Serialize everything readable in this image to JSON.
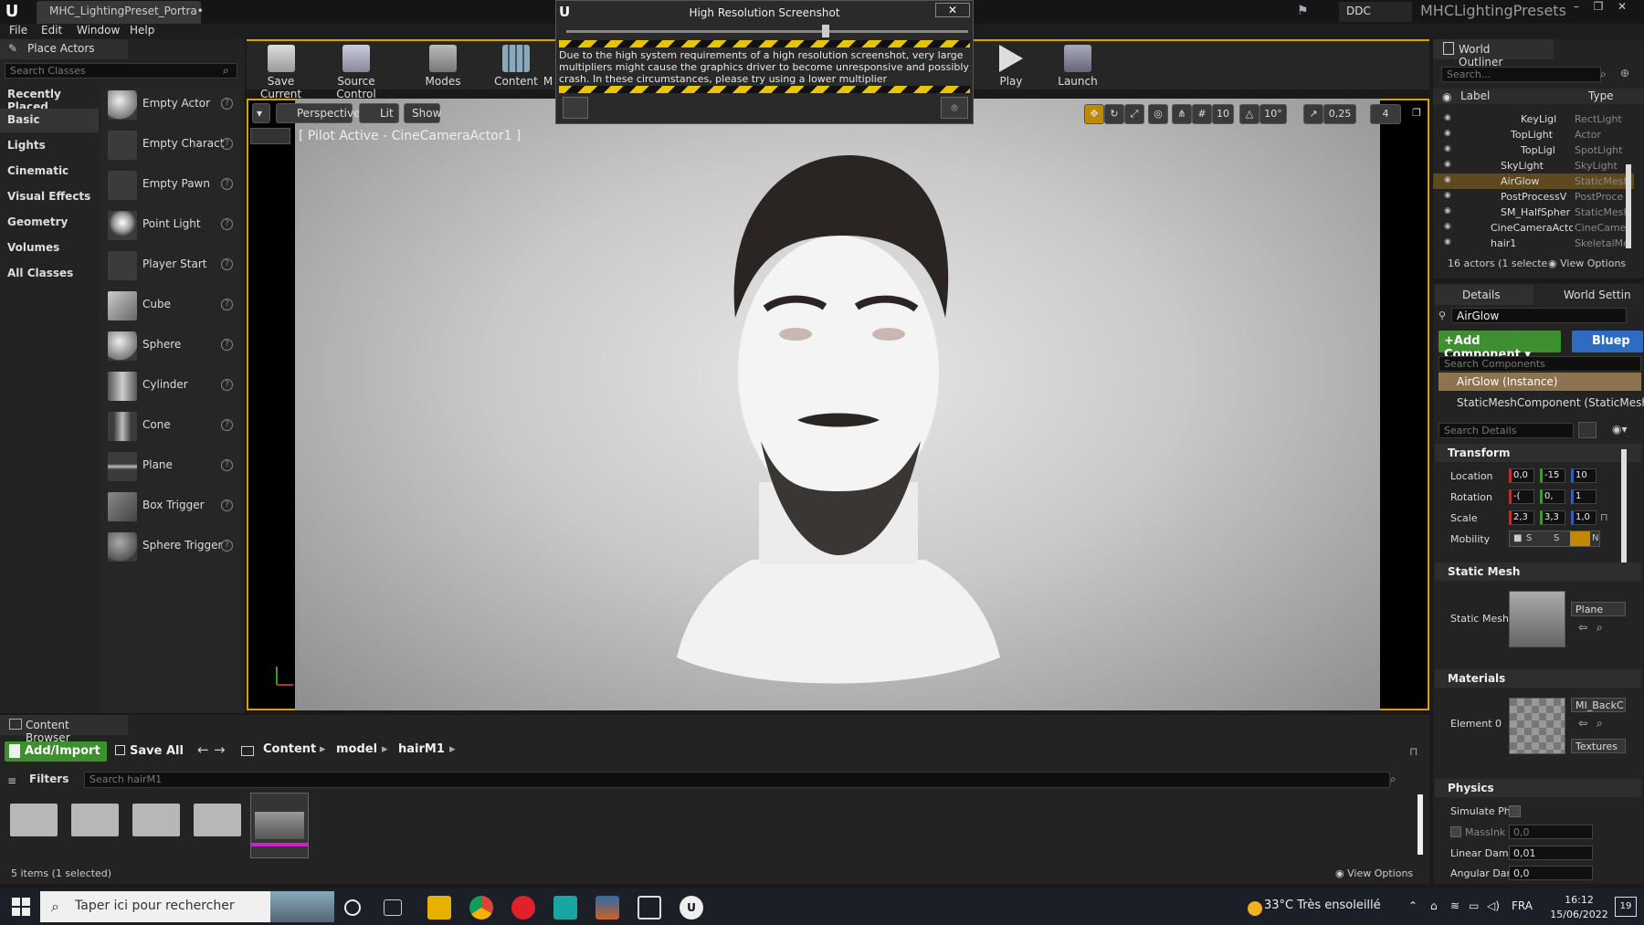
{
  "titlebar": {
    "tab": "MHC_LightingPreset_Portra•",
    "ddc": "DDC",
    "project": "MHCLightingPresets"
  },
  "menu": [
    "File",
    "Edit",
    "Window",
    "Help"
  ],
  "place_actors": {
    "tab": "Place Actors",
    "search_placeholder": "Search Classes",
    "categories": [
      "Recently Placed",
      "Basic",
      "Lights",
      "Cinematic",
      "Visual Effects",
      "Geometry",
      "Volumes",
      "All Classes"
    ],
    "actors": [
      "Empty Actor",
      "Empty Charact",
      "Empty Pawn",
      "Point Light",
      "Player Start",
      "Cube",
      "Sphere",
      "Cylinder",
      "Cone",
      "Plane",
      "Box Trigger",
      "Sphere Trigger"
    ]
  },
  "toolbar": {
    "save": "Save Current",
    "source": "Source Control",
    "modes": "Modes",
    "content": "Content",
    "m": "M",
    "play": "Play",
    "launch": "Launch"
  },
  "viewport": {
    "perspective": "Perspective",
    "lit": "Lit",
    "show": "Show",
    "pilot": "[ Pilot Active - CineCameraActor1 ]",
    "grid": "10",
    "angle": "10°",
    "scale": "0,25",
    "speed": "4"
  },
  "dialog": {
    "title": "High Resolution Screenshot",
    "close": "✕",
    "message": "Due to the high system requirements of a high resolution screenshot, very large multipliers might cause the graphics driver to become unresponsive and possibly crash. In these circumstances, please try using a lower multiplier"
  },
  "content_browser": {
    "tab": "Content Browser",
    "add": "Add/Import",
    "save_all": "Save All",
    "crumbs": [
      "Content",
      "model",
      "hairM1"
    ],
    "filters": "Filters",
    "search_placeholder": "Search hairM1",
    "status": "5 items (1 selected)",
    "view_options": "View Options"
  },
  "outliner": {
    "tab": "World Outliner",
    "search_placeholder": "Search...",
    "col_label": "Label",
    "col_type": "Type",
    "rows": [
      {
        "name": "KeyLigl",
        "type": "RectLight",
        "indent": 3
      },
      {
        "name": "TopLight",
        "type": "Actor",
        "indent": 2
      },
      {
        "name": "TopLigl",
        "type": "SpotLight",
        "indent": 3
      },
      {
        "name": "SkyLight",
        "type": "SkyLight",
        "indent": 1
      },
      {
        "name": "AirGlow",
        "type": "StaticMesh",
        "indent": 1,
        "selected": true
      },
      {
        "name": "PostProcessV",
        "type": "PostProce",
        "indent": 1
      },
      {
        "name": "SM_HalfSpher",
        "type": "StaticMesh",
        "indent": 1
      },
      {
        "name": "CineCameraActo",
        "type": "CineCame",
        "indent": 0
      },
      {
        "name": "hair1",
        "type": "SkeletalMe",
        "indent": 0
      }
    ],
    "status": "16 actors (1 selecte",
    "view_options": "View Options"
  },
  "details": {
    "tab_details": "Details",
    "tab_world": "World Settin",
    "name": "AirGlow",
    "add_component": "Add Component",
    "blueprint": "Bluep",
    "comp_search": "Search Components",
    "instance": "AirGlow (Instance)",
    "mesh_comp": "StaticMeshComponent (StaticMeshC",
    "details_search": "Search Details",
    "sections": {
      "transform": "Transform",
      "static_mesh": "Static Mesh",
      "materials": "Materials",
      "physics": "Physics"
    },
    "location": {
      "label": "Location",
      "x": "0,0",
      "y": "-15",
      "z": "10"
    },
    "rotation": {
      "label": "Rotation",
      "x": "-(",
      "y": "0,",
      "z": "1"
    },
    "scale": {
      "label": "Scale",
      "x": "2,3",
      "y": "3,3",
      "z": "1,0"
    },
    "mobility": {
      "label": "Mobility",
      "s1": "S",
      "s2": "S",
      "s3": "N"
    },
    "static_mesh_label": "Static Mesh",
    "static_mesh_value": "Plane",
    "element0": "Element 0",
    "material_value": "MI_BackC",
    "textures": "Textures",
    "simulate": "Simulate Ph",
    "mass": "MassInk",
    "mass_value": "0,0",
    "linear_damp": "Linear Damp",
    "linear_damp_value": "0,01",
    "angular_damp": "Angular Dam",
    "angular_damp_value": "0,0"
  },
  "taskbar": {
    "search": "Taper ici pour rechercher",
    "weather": "33°C  Très ensoleillé",
    "lang": "FRA",
    "time": "16:12",
    "date": "15/06/2022",
    "badge": "19"
  }
}
